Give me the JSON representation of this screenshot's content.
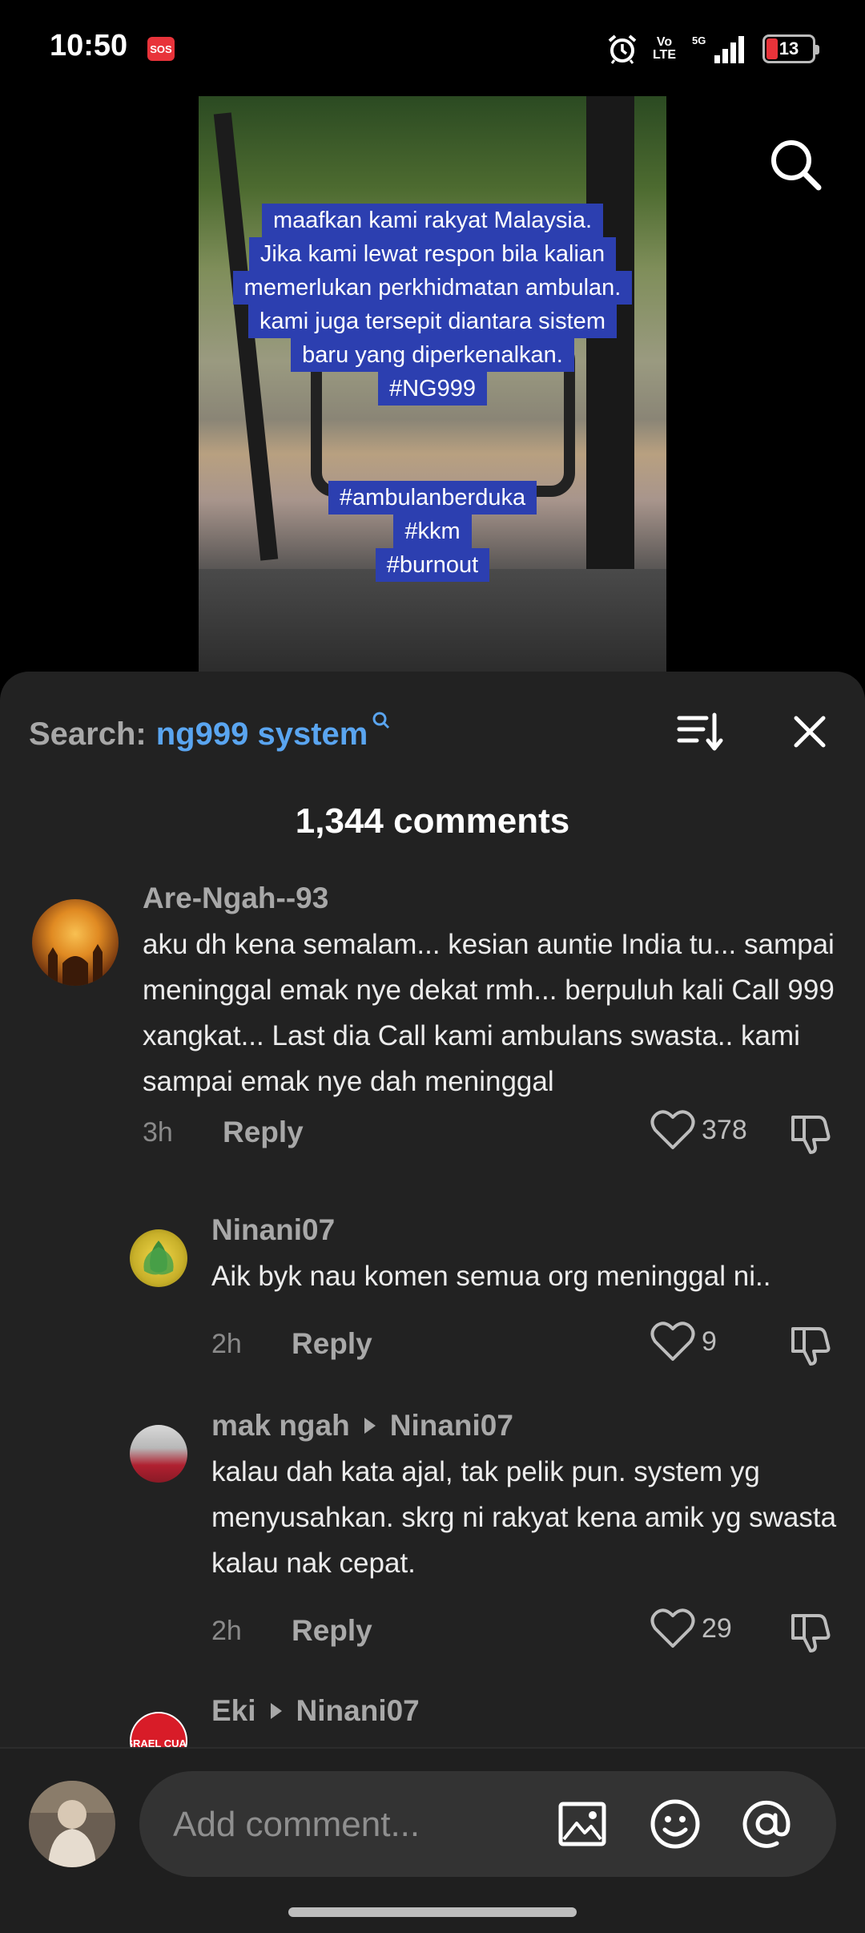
{
  "status_bar": {
    "time": "10:50",
    "sos": "SOS",
    "network": "Vo\nLTE",
    "signal_label": "5G",
    "battery": "13",
    "icons": [
      "alarm-icon",
      "signal-icon",
      "battery-icon"
    ]
  },
  "video": {
    "caption_top": [
      "maafkan kami rakyat Malaysia.",
      "Jika kami lewat respon bila kalian",
      "memerlukan perkhidmatan ambulan.",
      "kami juga tersepit diantara sistem",
      "baru yang diperkenalkan.",
      "#NG999"
    ],
    "caption_bottom": [
      "#ambulanberduka",
      "#kkm",
      "#burnout"
    ]
  },
  "comments_panel": {
    "search_label": "Search:",
    "search_term": "ng999 system",
    "count": "1,344 comments",
    "comments": [
      {
        "user": "Are-Ngah--93",
        "reply_to": "",
        "text": "aku dh kena semalam... kesian auntie India tu... sampai meninggal emak nye dekat rmh... berpuluh kali Call 999 xangkat... Last dia Call kami ambulans swasta.. kami sampai emak nye dah meninggal",
        "time": "3h",
        "reply_label": "Reply",
        "likes": "378"
      },
      {
        "user": "Ninani07",
        "reply_to": "",
        "text": "Aik byk nau komen semua org meninggal ni..",
        "time": "2h",
        "reply_label": "Reply",
        "likes": "9"
      },
      {
        "user": "mak ngah",
        "reply_to": "Ninani07",
        "text": "kalau dah kata ajal, tak pelik pun. system yg menyusahkan. skrg ni rakyat kena amik yg swasta kalau nak cepat.",
        "time": "2h",
        "reply_label": "Reply",
        "likes": "29"
      },
      {
        "user": "Eki",
        "reply_to": "Ninani07",
        "avatar_text": "ISRAEL CUAK"
      }
    ]
  },
  "input_bar": {
    "placeholder": "Add comment..."
  },
  "colors": {
    "sheet_bg": "#222222",
    "accent_link": "#5aa5f0",
    "caption_bg": "#2c3fb0",
    "sos_red": "#e8333a"
  }
}
